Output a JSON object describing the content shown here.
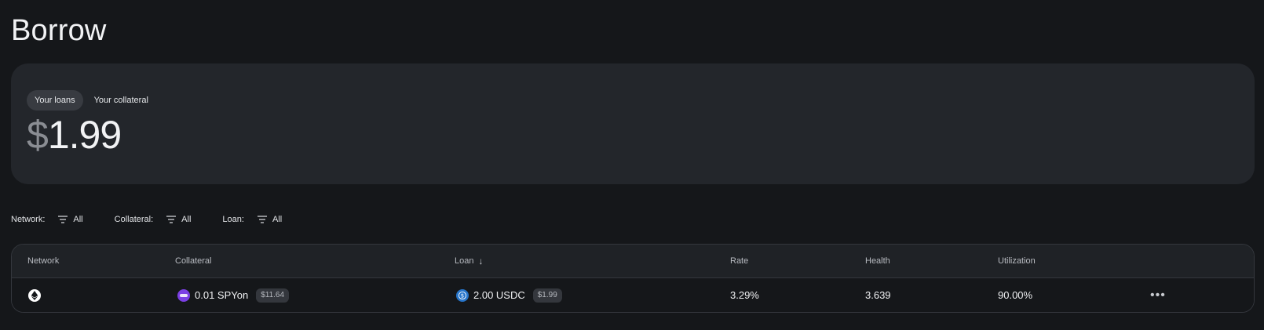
{
  "page": {
    "title": "Borrow"
  },
  "summary": {
    "toggles": [
      "Your loans",
      "Your collateral"
    ],
    "active_toggle": "Your loans",
    "currency_symbol": "$",
    "amount": "1.99"
  },
  "filters": [
    {
      "label": "Network:",
      "value": "All"
    },
    {
      "label": "Collateral:",
      "value": "All"
    },
    {
      "label": "Loan:",
      "value": "All"
    }
  ],
  "table": {
    "columns": {
      "network": "Network",
      "collateral": "Collateral",
      "loan": "Loan",
      "loan_sort_icon": "arrow-down-icon",
      "rate": "Rate",
      "health": "Health",
      "utilization": "Utilization"
    },
    "rows": [
      {
        "network_icon": "ethereum-icon",
        "collateral": {
          "icon": "spyon-token-icon",
          "amount": "0.01 SPYon",
          "usd": "$11.64"
        },
        "loan": {
          "icon": "usdc-token-icon",
          "amount": "2.00 USDC",
          "usd": "$1.99"
        },
        "rate": "3.29%",
        "health": "3.639",
        "utilization": "90.00%",
        "actions_icon": "more-horizontal-icon"
      }
    ]
  },
  "colors": {
    "background": "#15171a",
    "card": "#23262b",
    "spyon": "#7b3fe4",
    "usdc": "#2775ca"
  }
}
